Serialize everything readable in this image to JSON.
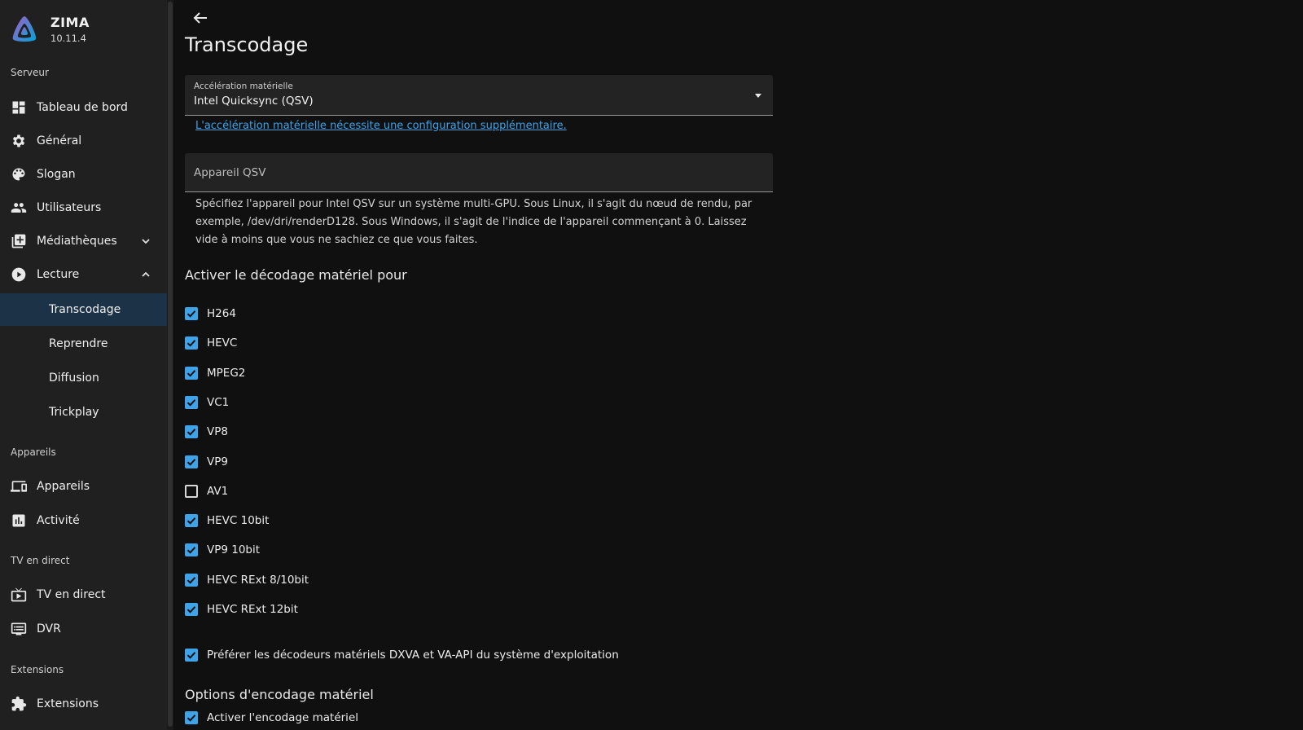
{
  "brand": {
    "name": "ZIMA",
    "version": "10.11.4"
  },
  "sidebar": {
    "sections": [
      {
        "label": "Serveur"
      },
      {
        "label": "Appareils"
      },
      {
        "label": "TV en direct"
      },
      {
        "label": "Extensions"
      }
    ],
    "items": [
      {
        "label": "Tableau de bord",
        "icon": "dashboard-icon"
      },
      {
        "label": "Général",
        "icon": "gear-icon"
      },
      {
        "label": "Slogan",
        "icon": "palette-icon"
      },
      {
        "label": "Utilisateurs",
        "icon": "users-icon"
      },
      {
        "label": "Médiathèques",
        "icon": "library-icon"
      },
      {
        "label": "Lecture",
        "icon": "play-circle-icon"
      },
      {
        "label": "Transcodage"
      },
      {
        "label": "Reprendre"
      },
      {
        "label": "Diffusion"
      },
      {
        "label": "Trickplay"
      },
      {
        "label": "Appareils",
        "icon": "devices-icon"
      },
      {
        "label": "Activité",
        "icon": "activity-chart-icon"
      },
      {
        "label": "TV en direct",
        "icon": "live-tv-icon"
      },
      {
        "label": "DVR",
        "icon": "dvr-icon"
      },
      {
        "label": "Extensions",
        "icon": "puzzle-icon"
      }
    ]
  },
  "main": {
    "title": "Transcodage",
    "hw_accel": {
      "label": "Accélération matérielle",
      "value": "Intel Quicksync (QSV)"
    },
    "hint_link": "L'accélération matérielle nécessite une configuration supplémentaire.",
    "qsv_device": {
      "placeholder": "Appareil QSV",
      "value": ""
    },
    "qsv_description": "Spécifiez l'appareil pour Intel QSV sur un système multi-GPU. Sous Linux, il s'agit du nœud de rendu, par exemple, /dev/dri/renderD128. Sous Windows, il s'agit de l'indice de l'appareil commençant à 0. Laissez vide à moins que vous ne sachiez ce que vous faites.",
    "decode_heading": "Activer le décodage matériel pour",
    "codecs": [
      {
        "label": "H264",
        "checked": true
      },
      {
        "label": "HEVC",
        "checked": true
      },
      {
        "label": "MPEG2",
        "checked": true
      },
      {
        "label": "VC1",
        "checked": true
      },
      {
        "label": "VP8",
        "checked": true
      },
      {
        "label": "VP9",
        "checked": true
      },
      {
        "label": "AV1",
        "checked": false
      },
      {
        "label": "HEVC 10bit",
        "checked": true
      },
      {
        "label": "VP9 10bit",
        "checked": true
      },
      {
        "label": "HEVC RExt 8/10bit",
        "checked": true
      },
      {
        "label": "HEVC RExt 12bit",
        "checked": true
      }
    ],
    "prefer_os_decoders": {
      "label": "Préférer les décodeurs matériels DXVA et VA-API du système d'exploitation",
      "checked": true
    },
    "encode_heading": "Options d'encodage matériel",
    "enable_encoding": {
      "label": "Activer l'encodage matériel",
      "checked": true
    }
  },
  "colors": {
    "accent": "#3ea3e8",
    "active_nav": "#1c3347",
    "sidebar_bg": "#202020",
    "page_bg": "#101010"
  }
}
